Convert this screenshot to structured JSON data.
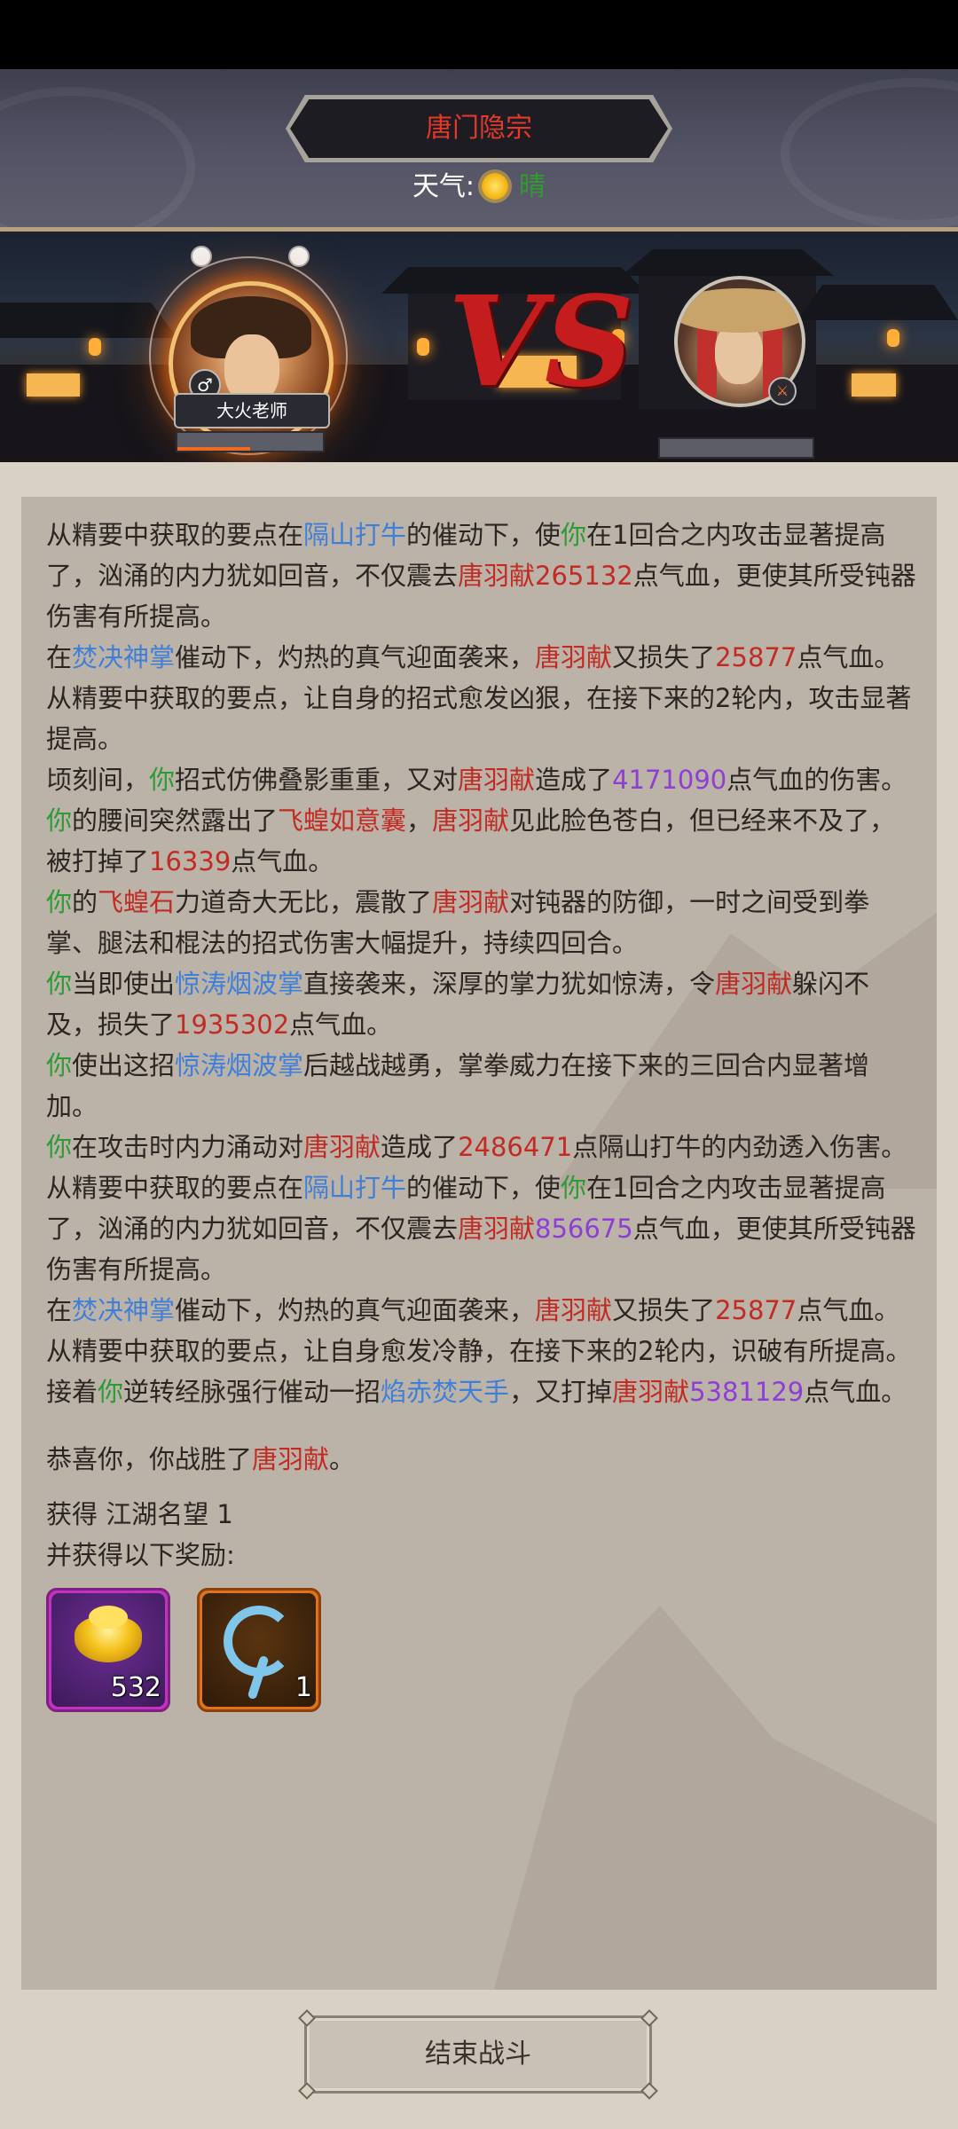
{
  "header": {
    "title": "唐门隐宗",
    "weather_label": "天气:",
    "weather_value": "晴"
  },
  "battle": {
    "player_name": "大火老师",
    "player_gender_icon": "male-icon",
    "enemy_weapon_icon": "sword-icon"
  },
  "log": {
    "entries": [
      [
        [
          "从精要中获取的要点在",
          "text"
        ],
        [
          "隔山打牛",
          "skill"
        ],
        [
          "的催动下，使",
          "text"
        ],
        [
          "你",
          "player"
        ],
        [
          "在1回合之内攻击显著提高了，汹涌的内力犹如回音，不仅震去",
          "text"
        ],
        [
          "唐羽献",
          "enemy"
        ],
        [
          "265132",
          "num-red"
        ],
        [
          "点气血，更使其所受钝器伤害有所提高。",
          "text"
        ]
      ],
      [
        [
          "在",
          "text"
        ],
        [
          "焚决神掌",
          "skill"
        ],
        [
          "催动下，灼热的真气迎面袭来，",
          "text"
        ],
        [
          "唐羽献",
          "enemy"
        ],
        [
          "又损失了",
          "text"
        ],
        [
          "25877",
          "num-red"
        ],
        [
          "点气血。",
          "text"
        ]
      ],
      [
        [
          "从精要中获取的要点，让自身的招式愈发凶狠，在接下来的2轮内，攻击显著提高。",
          "text"
        ]
      ],
      [
        [
          "顷刻间，",
          "text"
        ],
        [
          "你",
          "player"
        ],
        [
          "招式仿佛叠影重重，又对",
          "text"
        ],
        [
          "唐羽献",
          "enemy"
        ],
        [
          "造成了",
          "text"
        ],
        [
          "4171090",
          "num-purple"
        ],
        [
          "点气血的伤害。",
          "text"
        ]
      ],
      [
        [
          "你",
          "player"
        ],
        [
          "的腰间突然露出了",
          "text"
        ],
        [
          "飞蝗如意囊",
          "item"
        ],
        [
          "，",
          "text"
        ],
        [
          "唐羽献",
          "enemy"
        ],
        [
          "见此脸色苍白，但已经来不及了，被打掉了",
          "text"
        ],
        [
          "16339",
          "num-red"
        ],
        [
          "点气血。",
          "text"
        ]
      ],
      [
        [
          "你",
          "player"
        ],
        [
          "的",
          "text"
        ],
        [
          "飞蝗石",
          "item"
        ],
        [
          "力道奇大无比，震散了",
          "text"
        ],
        [
          "唐羽献",
          "enemy"
        ],
        [
          "对钝器的防御，一时之间受到拳掌、腿法和棍法的招式伤害大幅提升，持续四回合。",
          "text"
        ]
      ],
      [
        [
          "你",
          "player"
        ],
        [
          "当即使出",
          "text"
        ],
        [
          "惊涛烟波掌",
          "skill"
        ],
        [
          "直接袭来，深厚的掌力犹如惊涛，令",
          "text"
        ],
        [
          "唐羽献",
          "enemy"
        ],
        [
          "躲闪不及，损失了",
          "text"
        ],
        [
          "1935302",
          "num-red"
        ],
        [
          "点气血。",
          "text"
        ]
      ],
      [
        [
          "你",
          "player"
        ],
        [
          "使出这招",
          "text"
        ],
        [
          "惊涛烟波掌",
          "skill"
        ],
        [
          "后越战越勇，掌拳威力在接下来的三回合内显著增加。",
          "text"
        ]
      ],
      [
        [
          "你",
          "player"
        ],
        [
          "在攻击时内力涌动对",
          "text"
        ],
        [
          "唐羽献",
          "enemy"
        ],
        [
          "造成了",
          "text"
        ],
        [
          "2486471",
          "num-red"
        ],
        [
          "点隔山打牛的内劲透入伤害。",
          "text"
        ]
      ],
      [
        [
          "从精要中获取的要点在",
          "text"
        ],
        [
          "隔山打牛",
          "skill"
        ],
        [
          "的催动下，使",
          "text"
        ],
        [
          "你",
          "player"
        ],
        [
          "在1回合之内攻击显著提高了，汹涌的内力犹如回音，不仅震去",
          "text"
        ],
        [
          "唐羽献",
          "enemy"
        ],
        [
          "856675",
          "num-purple"
        ],
        [
          "点气血，更使其所受钝器伤害有所提高。",
          "text"
        ]
      ],
      [
        [
          "在",
          "text"
        ],
        [
          "焚决神掌",
          "skill"
        ],
        [
          "催动下，灼热的真气迎面袭来，",
          "text"
        ],
        [
          "唐羽献",
          "enemy"
        ],
        [
          "又损失了",
          "text"
        ],
        [
          "25877",
          "num-red"
        ],
        [
          "点气血。",
          "text"
        ]
      ],
      [
        [
          "从精要中获取的要点，让自身愈发冷静，在接下来的2轮内，识破有所提高。",
          "text"
        ]
      ],
      [
        [
          "接着",
          "text"
        ],
        [
          "你",
          "player"
        ],
        [
          "逆转经脉强行催动一招",
          "text"
        ],
        [
          "焰赤焚天手",
          "skill"
        ],
        [
          "，又打掉",
          "text"
        ],
        [
          "唐羽献",
          "enemy"
        ],
        [
          "5381129",
          "num-purple"
        ],
        [
          "点气血。",
          "text"
        ]
      ]
    ],
    "victory": [
      [
        "恭喜你，你战胜了",
        "text"
      ],
      [
        "唐羽献",
        "enemy"
      ],
      [
        "。",
        "text"
      ]
    ],
    "reward_reputation": "获得 江湖名望 1",
    "reward_intro": "并获得以下奖励:"
  },
  "rewards": [
    {
      "icon": "gold-ingot-icon",
      "count": "532",
      "rarity_color": "#c033c0"
    },
    {
      "icon": "blue-swirl-icon",
      "count": "1",
      "rarity_color": "#e0731a"
    }
  ],
  "end_button": "结束战斗",
  "colors": {
    "player": "#2c9b34",
    "enemy": "#c22b24",
    "skill": "#3f7fd8",
    "number_red": "#c22b24",
    "number_purple": "#8e3ed4",
    "title": "#e23a2a"
  }
}
